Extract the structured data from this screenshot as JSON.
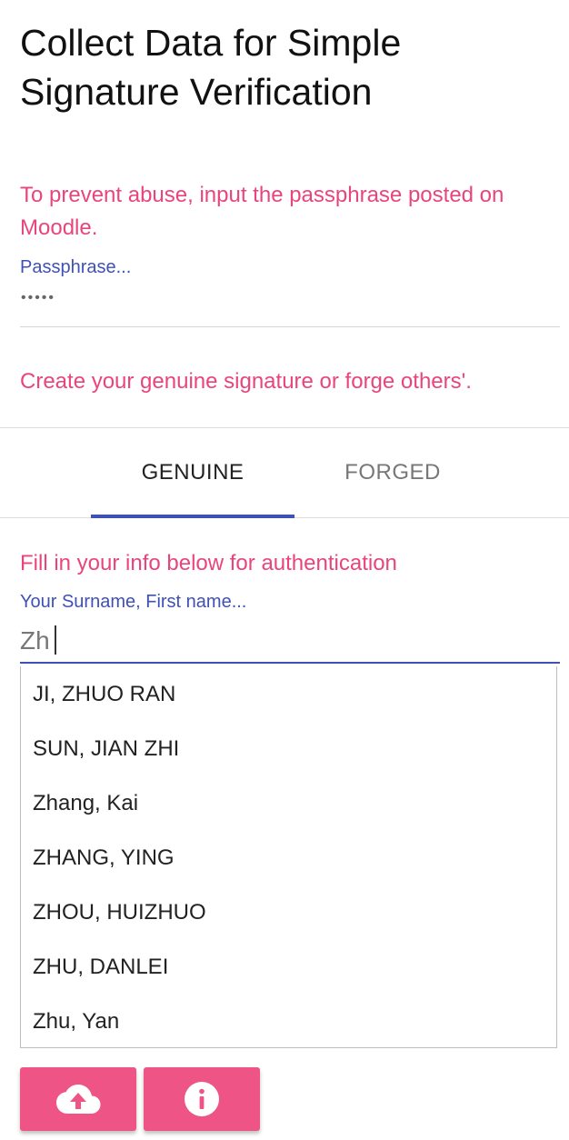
{
  "header": {
    "title": "Collect Data for Simple Signature Verification"
  },
  "auth": {
    "abuse_message": "To prevent abuse, input the passphrase posted on Moodle.",
    "passphrase_label": "Passphrase...",
    "passphrase_value": "•••••"
  },
  "create_message": "Create your genuine signature or forge others'.",
  "tabs": [
    {
      "label": "GENUINE",
      "active": true
    },
    {
      "label": "FORGED",
      "active": false
    }
  ],
  "form": {
    "auth_message": "Fill in your info below for authentication",
    "name_label": "Your Surname, First name...",
    "name_value": "Zh"
  },
  "suggestions": [
    "JI, ZHUO RAN",
    "SUN, JIAN ZHI",
    "Zhang, Kai",
    "ZHANG, YING",
    "ZHOU, HUIZHUO",
    "ZHU, DANLEI",
    "Zhu, Yan"
  ],
  "buttons": {
    "upload_icon": "cloud-upload-icon",
    "info_icon": "info-icon"
  },
  "colors": {
    "accent": "#e9457c",
    "primary": "#3f51b5",
    "button": "#ee5586"
  }
}
